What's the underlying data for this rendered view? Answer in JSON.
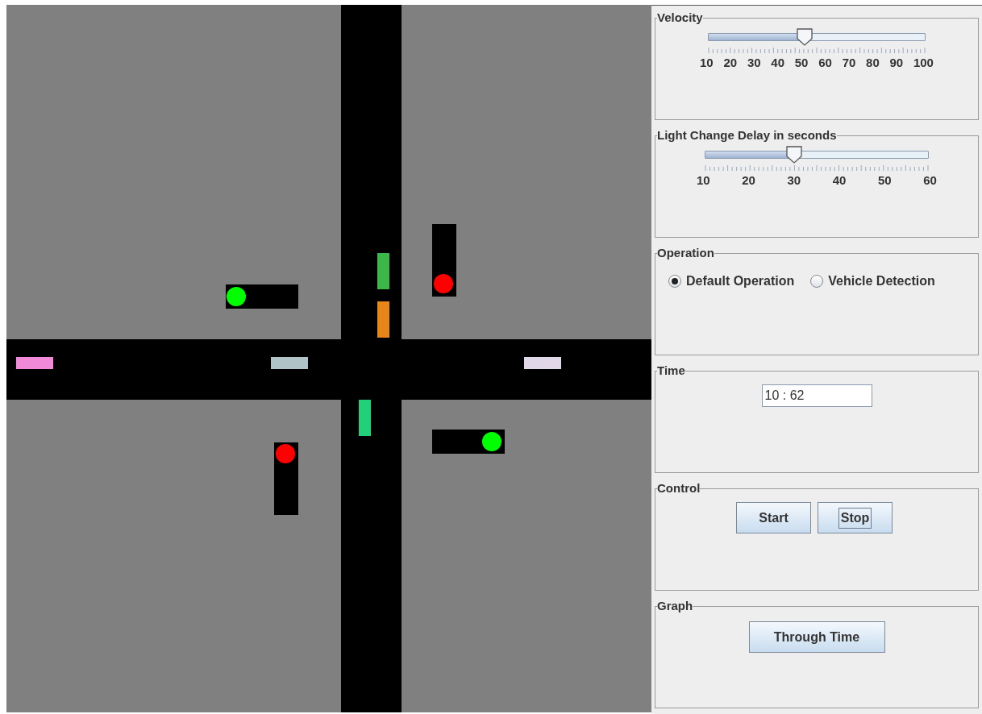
{
  "simulation": {
    "cars": [
      {
        "color": "#f08ad8"
      },
      {
        "color": "#b0c4c8"
      },
      {
        "color": "#e0d8e8"
      },
      {
        "color": "#3cb84a"
      },
      {
        "color": "#e8861a"
      },
      {
        "color": "#22d07a"
      }
    ],
    "lights": [
      {
        "color": "#00ff00"
      },
      {
        "color": "#ff0000"
      },
      {
        "color": "#00ff00"
      },
      {
        "color": "#ff0000"
      }
    ]
  },
  "velocity": {
    "title": "Velocity",
    "level": 0.444,
    "labels": [
      "10",
      "20",
      "30",
      "40",
      "50",
      "60",
      "70",
      "80",
      "90",
      "100"
    ]
  },
  "delay": {
    "title": "Light Change Delay in seconds",
    "level": 0.4,
    "labels": [
      "10",
      "20",
      "30",
      "40",
      "50",
      "60"
    ]
  },
  "operation": {
    "title": "Operation",
    "options": [
      {
        "label": "Default Operation",
        "selected": true
      },
      {
        "label": "Vehicle Detection",
        "selected": false
      }
    ]
  },
  "time": {
    "title": "Time",
    "value": "10 : 62"
  },
  "control": {
    "title": "Control",
    "buttons": [
      {
        "label": "Start",
        "focused": false
      },
      {
        "label": "Stop",
        "focused": true
      }
    ]
  },
  "graph": {
    "title": "Graph",
    "buttons": [
      {
        "label": "Through Time",
        "focused": false
      }
    ]
  }
}
